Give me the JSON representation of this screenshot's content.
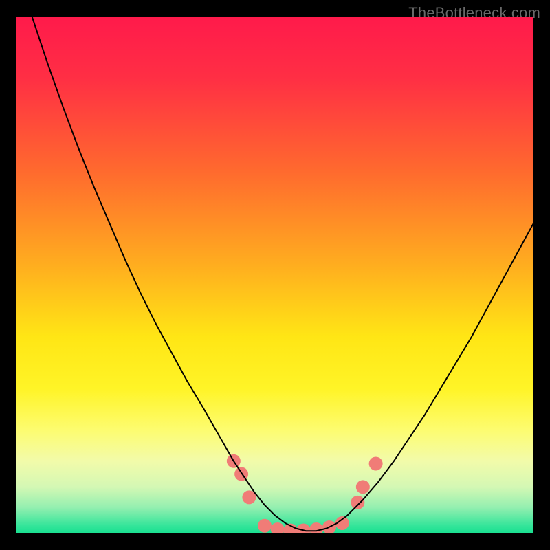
{
  "watermark": "TheBottleneck.com",
  "chart_data": {
    "type": "line",
    "title": "",
    "xlabel": "",
    "ylabel": "",
    "xlim": [
      0,
      100
    ],
    "ylim": [
      0,
      100
    ],
    "grid": false,
    "legend": false,
    "background_gradient_stops": [
      {
        "offset": 0.0,
        "color": "#ff1a4b"
      },
      {
        "offset": 0.12,
        "color": "#ff2f44"
      },
      {
        "offset": 0.3,
        "color": "#ff6a2e"
      },
      {
        "offset": 0.48,
        "color": "#ffad1f"
      },
      {
        "offset": 0.62,
        "color": "#ffe615"
      },
      {
        "offset": 0.72,
        "color": "#fff427"
      },
      {
        "offset": 0.8,
        "color": "#fdfc70"
      },
      {
        "offset": 0.86,
        "color": "#f2fbaa"
      },
      {
        "offset": 0.91,
        "color": "#d4f8b4"
      },
      {
        "offset": 0.95,
        "color": "#93efb0"
      },
      {
        "offset": 0.985,
        "color": "#34e59a"
      },
      {
        "offset": 1.0,
        "color": "#18df90"
      }
    ],
    "series": [
      {
        "name": "bottleneck-curve",
        "color": "#000000",
        "stroke_width": 2,
        "x": [
          0.0,
          3.0,
          6.0,
          9.0,
          12.0,
          15.0,
          18.0,
          21.0,
          24.0,
          27.0,
          30.0,
          33.0,
          36.0,
          38.0,
          40.0,
          42.0,
          44.0,
          46.0,
          48.0,
          50.0,
          52.0,
          54.0,
          56.0,
          58.0,
          60.0,
          62.0,
          64.0,
          67.0,
          70.0,
          73.0,
          76.0,
          79.0,
          82.0,
          85.0,
          88.0,
          91.0,
          94.0,
          97.0,
          100.0
        ],
        "y": [
          110.0,
          100.0,
          91.0,
          82.5,
          74.5,
          67.0,
          60.0,
          53.0,
          46.5,
          40.5,
          35.0,
          29.5,
          24.5,
          21.0,
          17.5,
          14.0,
          11.0,
          8.0,
          5.5,
          3.5,
          2.0,
          1.0,
          0.5,
          0.5,
          1.0,
          2.0,
          3.5,
          6.5,
          10.0,
          14.0,
          18.5,
          23.0,
          28.0,
          33.0,
          38.0,
          43.5,
          49.0,
          54.5,
          60.0
        ]
      }
    ],
    "markers": {
      "name": "dot-cluster",
      "color": "#f07c77",
      "radius": 10,
      "points": [
        {
          "x": 42.0,
          "y": 14.0
        },
        {
          "x": 43.5,
          "y": 11.5
        },
        {
          "x": 45.0,
          "y": 7.0
        },
        {
          "x": 48.0,
          "y": 1.5
        },
        {
          "x": 50.5,
          "y": 0.8
        },
        {
          "x": 53.0,
          "y": 0.6
        },
        {
          "x": 55.5,
          "y": 0.6
        },
        {
          "x": 58.0,
          "y": 0.8
        },
        {
          "x": 60.5,
          "y": 1.2
        },
        {
          "x": 63.0,
          "y": 2.0
        },
        {
          "x": 66.0,
          "y": 6.0
        },
        {
          "x": 67.0,
          "y": 9.0
        },
        {
          "x": 69.5,
          "y": 13.5
        }
      ]
    }
  }
}
